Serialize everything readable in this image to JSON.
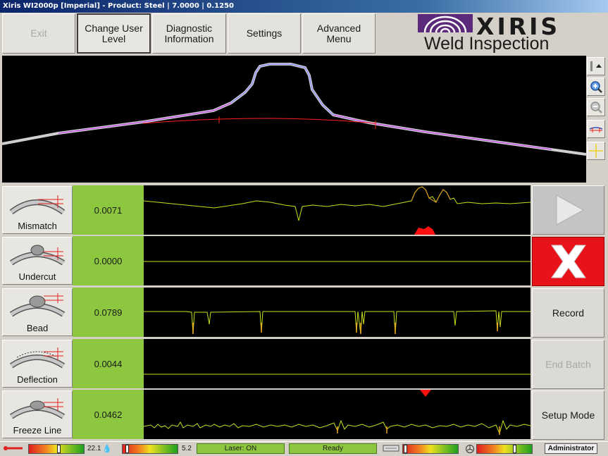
{
  "window": {
    "title": "Xiris WI2000p [Imperial] - Product: Steel | 7.0000 | 0.1250"
  },
  "toolbar": {
    "exit_label": "Exit",
    "change_user_level_label": "Change User\nLevel",
    "diagnostic_label": "Diagnostic\nInformation",
    "settings_label": "Settings",
    "advanced_menu_label": "Advanced\nMenu"
  },
  "logo": {
    "brand": "XIRIS",
    "subtitle": "Weld Inspection",
    "accent_color": "#5b2a7a"
  },
  "profile_tools": [
    "scroll-up-icon",
    "zoom-in-icon",
    "zoom-out-icon",
    "profile-marker-icon",
    "crosshair-icon"
  ],
  "channels": [
    {
      "label": "Mismatch",
      "value": "0.0071",
      "icon": "mismatch-icon"
    },
    {
      "label": "Undercut",
      "value": "0.0000",
      "icon": "undercut-icon"
    },
    {
      "label": "Bead",
      "value": "0.0789",
      "icon": "bead-icon"
    },
    {
      "label": "Deflection",
      "value": "0.0044",
      "icon": "deflection-icon"
    },
    {
      "label": "Freeze Line",
      "value": "0.0462",
      "icon": "freeze-line-icon"
    }
  ],
  "controls": {
    "play_icon": "play-icon",
    "stop_icon": "stop-x-icon",
    "record_label": "Record",
    "end_batch_label": "End Batch",
    "setup_mode_label": "Setup Mode"
  },
  "status": {
    "temperature_icon": "thermometer-icon",
    "temperature_level": 0.55,
    "temperature_value": "22.1",
    "humidity_icon": "humidity-icon",
    "humidity_level": 0.05,
    "humidity_value": "5.2",
    "laser_label": "Laser: ON",
    "ready_label": "Ready",
    "light_icon": "light-icon",
    "light_level": 0.02,
    "fan_icon": "fan-icon",
    "fan_level": 0.7,
    "user_label": "Administrator",
    "ok_color": "#8dc63f"
  }
}
